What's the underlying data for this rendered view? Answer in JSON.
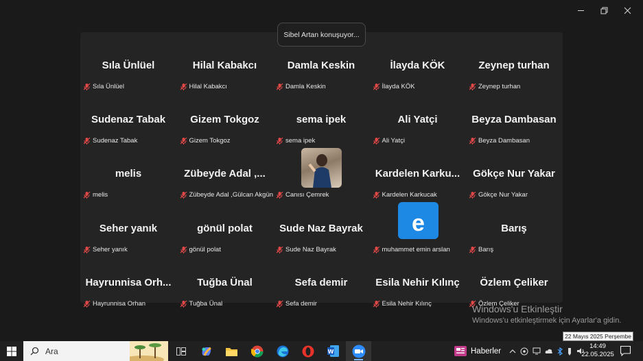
{
  "speaker_toast": "Sibel Artan konuşuyor...",
  "tiles": [
    {
      "name": "Sıla Ünlüel",
      "label": "Sıla Ünlüel"
    },
    {
      "name": "Hilal Kabakcı",
      "label": "Hilal Kabakcı"
    },
    {
      "name": "Damla Keskin",
      "label": "Damla Keskin"
    },
    {
      "name": "İlayda KÖK",
      "label": "İlayda KÖK"
    },
    {
      "name": "Zeynep turhan",
      "label": "Zeynep turhan"
    },
    {
      "name": "Sudenaz Tabak",
      "label": "Sudenaz Tabak"
    },
    {
      "name": "Gizem Tokgoz",
      "label": "Gizem Tokgoz"
    },
    {
      "name": "sema ipek",
      "label": "sema ipek"
    },
    {
      "name": "Ali Yatçi",
      "label": "Ali Yatçi"
    },
    {
      "name": "Beyza Dambasan",
      "label": "Beyza Dambasan"
    },
    {
      "name": "melis",
      "label": "melis"
    },
    {
      "name": "Zübeyde Adal ,...",
      "label": "Zübeyde Adal ,Gülcan Akgün"
    },
    {
      "name": "",
      "label": "Canısı Çemrek"
    },
    {
      "name": "Kardelen Karku...",
      "label": "Kardelen Karkucak"
    },
    {
      "name": "Gökçe Nur Yakar",
      "label": "Gökçe Nur Yakar"
    },
    {
      "name": "Seher yanık",
      "label": "Seher yanık"
    },
    {
      "name": "gönül polat",
      "label": "gönül polat"
    },
    {
      "name": "Sude Naz Bayrak",
      "label": "Sude Naz Bayrak"
    },
    {
      "name": "",
      "label": "muhammet emin arslan"
    },
    {
      "name": "Barış",
      "label": "Barış"
    },
    {
      "name": "Hayrunnisa Orh...",
      "label": "Hayrunnisa Orhan"
    },
    {
      "name": "Tuğba Ünal",
      "label": "Tuğba Ünal"
    },
    {
      "name": "Sefa demir",
      "label": "Sefa demir"
    },
    {
      "name": "Esila Nehir Kılınç",
      "label": "Esila Nehir Kılınç"
    },
    {
      "name": "Özlem Çeliker",
      "label": "Özlem Çeliker"
    }
  ],
  "avatar_letter": "e",
  "activation": {
    "title": "Windows'u Etkinleştir",
    "subtitle": "Windows'u etkinleştirmek için Ayarlar'a gidin."
  },
  "date_tooltip": "22 Mayıs 2025 Perşembe",
  "taskbar": {
    "search_placeholder": "Ara",
    "news_label": "Haberler",
    "time": "14:49",
    "date": "22.05.2025",
    "apps": [
      "task-view-icon",
      "copilot-icon",
      "file-explorer-icon",
      "chrome-icon",
      "edge-icon",
      "opera-icon",
      "word-icon",
      "zoom-icon"
    ]
  },
  "colors": {
    "background": "#1a1a1a",
    "gallery": "#242424",
    "mute_red": "#e04848",
    "avatar_blue": "#1e88e5"
  }
}
